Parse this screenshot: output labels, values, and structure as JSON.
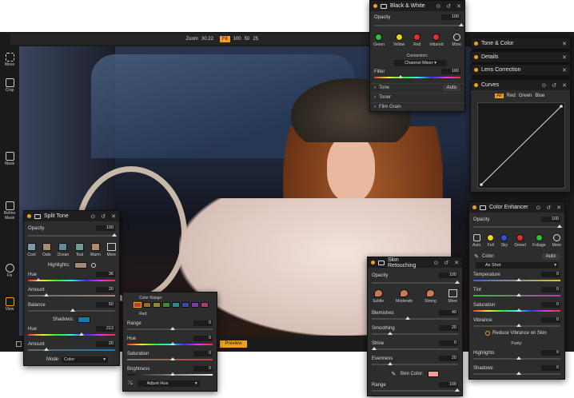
{
  "toolbar": {
    "zoom_label": "Zoom",
    "zoom_value": "30.22",
    "fit": "Fit",
    "z100": "100",
    "z50": "50",
    "z25": "25",
    "preview": "Preview"
  },
  "tools": [
    "Move",
    "Crop",
    "Mask",
    "Refine Mask",
    "Fix",
    "View"
  ],
  "black_white": {
    "title": "Black & White",
    "opacity_label": "Opacity",
    "opacity": "100",
    "filters": [
      {
        "label": "Green",
        "color": "#2ec02e"
      },
      {
        "label": "Yellow",
        "color": "#e8d81e"
      },
      {
        "label": "Red",
        "color": "#e03030"
      },
      {
        "label": "Infrared",
        "color": "#e03030"
      },
      {
        "label": "More",
        "color": "#2d2d2d"
      }
    ],
    "conversion_label": "Conversion:",
    "conversion_value": "Channel Mixer",
    "filter_label": "Filter",
    "filter_value": "100",
    "tone_label": "Tone",
    "tone_btn": "Auto",
    "toner_label": "Toner",
    "grain_label": "Film Grain"
  },
  "right_collapsed": {
    "tone_color": "Tone & Color",
    "details": "Details",
    "lens": "Lens Correction"
  },
  "curves": {
    "title": "Curves",
    "channels": [
      "All",
      "Red",
      "Green",
      "Blue"
    ]
  },
  "split_tone": {
    "title": "Split Tone",
    "opacity_label": "Opacity",
    "opacity": "100",
    "presets": [
      {
        "label": "Cool",
        "color": "#7b98a6"
      },
      {
        "label": "Oats",
        "color": "#a58d72"
      },
      {
        "label": "Ocean",
        "color": "#5f8a96"
      },
      {
        "label": "Teal",
        "color": "#6e9a94"
      },
      {
        "label": "Warm",
        "color": "#b08a6a"
      },
      {
        "label": "More",
        "color": "#2d2d2d"
      }
    ],
    "highlights_label": "Highlights:",
    "highlights_color": "#a08878",
    "hue_label": "Hue",
    "hue": "36",
    "amount_label": "Amount",
    "amount": "20",
    "balance_label": "Balance",
    "balance": "50",
    "shadows_label": "Shadows:",
    "shadows_color": "#1a7ab0",
    "s_hue_label": "Hue",
    "s_hue": "213",
    "s_amount_label": "Amount",
    "s_amount": "20",
    "mode_label": "Mode",
    "mode_value": "Color"
  },
  "hsl": {
    "color_range_label": "Color Range:",
    "swatches": [
      "#c83a2a",
      "#a06828",
      "#8a8a2a",
      "#3a8a3a",
      "#2a8a8a",
      "#3a4aa8",
      "#7a3aa8",
      "#a83a7a"
    ],
    "red_label": "Red:",
    "range_label": "Range",
    "range": "0",
    "hue_label": "Hue",
    "hue": "0",
    "saturation_label": "Saturation",
    "saturation": "0",
    "brightness_label": "Brightness",
    "brightness": "0",
    "adjust_label": "Adjust Hue"
  },
  "skin": {
    "title": "Skin Retouching",
    "opacity_label": "Opacity",
    "opacity": "100",
    "presets": [
      {
        "label": "Subtle",
        "color": "#c87a50"
      },
      {
        "label": "Moderate",
        "color": "#c87a50"
      },
      {
        "label": "Strong",
        "color": "#c87a50"
      },
      {
        "label": "More",
        "color": "#2d2d2d"
      }
    ],
    "blemishes_label": "Blemishes",
    "blemishes": "40",
    "smoothing_label": "Smoothing",
    "smoothing": "20",
    "shine_label": "Shine",
    "shine": "0",
    "evenness_label": "Evenness",
    "evenness": "20",
    "skin_color_label": "Skin Color:",
    "skin_color": "#f0a090",
    "range_label": "Range",
    "range": "100"
  },
  "color_enhancer": {
    "title": "Color Enhancer",
    "opacity_label": "Opacity",
    "opacity": "100",
    "presets": [
      {
        "label": "Auto",
        "color": "#2d2d2d"
      },
      {
        "label": "Fell",
        "color": "#e8d81e"
      },
      {
        "label": "Sky",
        "color": "#3050e0"
      },
      {
        "label": "Desert",
        "color": "#e03030"
      },
      {
        "label": "Foliage",
        "color": "#2ec02e"
      },
      {
        "label": "More",
        "color": "#2d2d2d"
      }
    ],
    "color_label": "Color:",
    "auto_btn": "Auto",
    "as_shot": "As Shot",
    "temperature_label": "Temperature",
    "temperature": "0",
    "tint_label": "Tint",
    "tint": "0",
    "saturation_label": "Saturation",
    "saturation": "0",
    "vibrance_label": "Vibrance",
    "vibrance": "0",
    "reduce_label": "Reduce Vibrance on Skin",
    "purity_label": "Purity:",
    "highlights_label": "Highlights",
    "highlights": "0",
    "shadows_label": "Shadows",
    "shadows": "0"
  }
}
